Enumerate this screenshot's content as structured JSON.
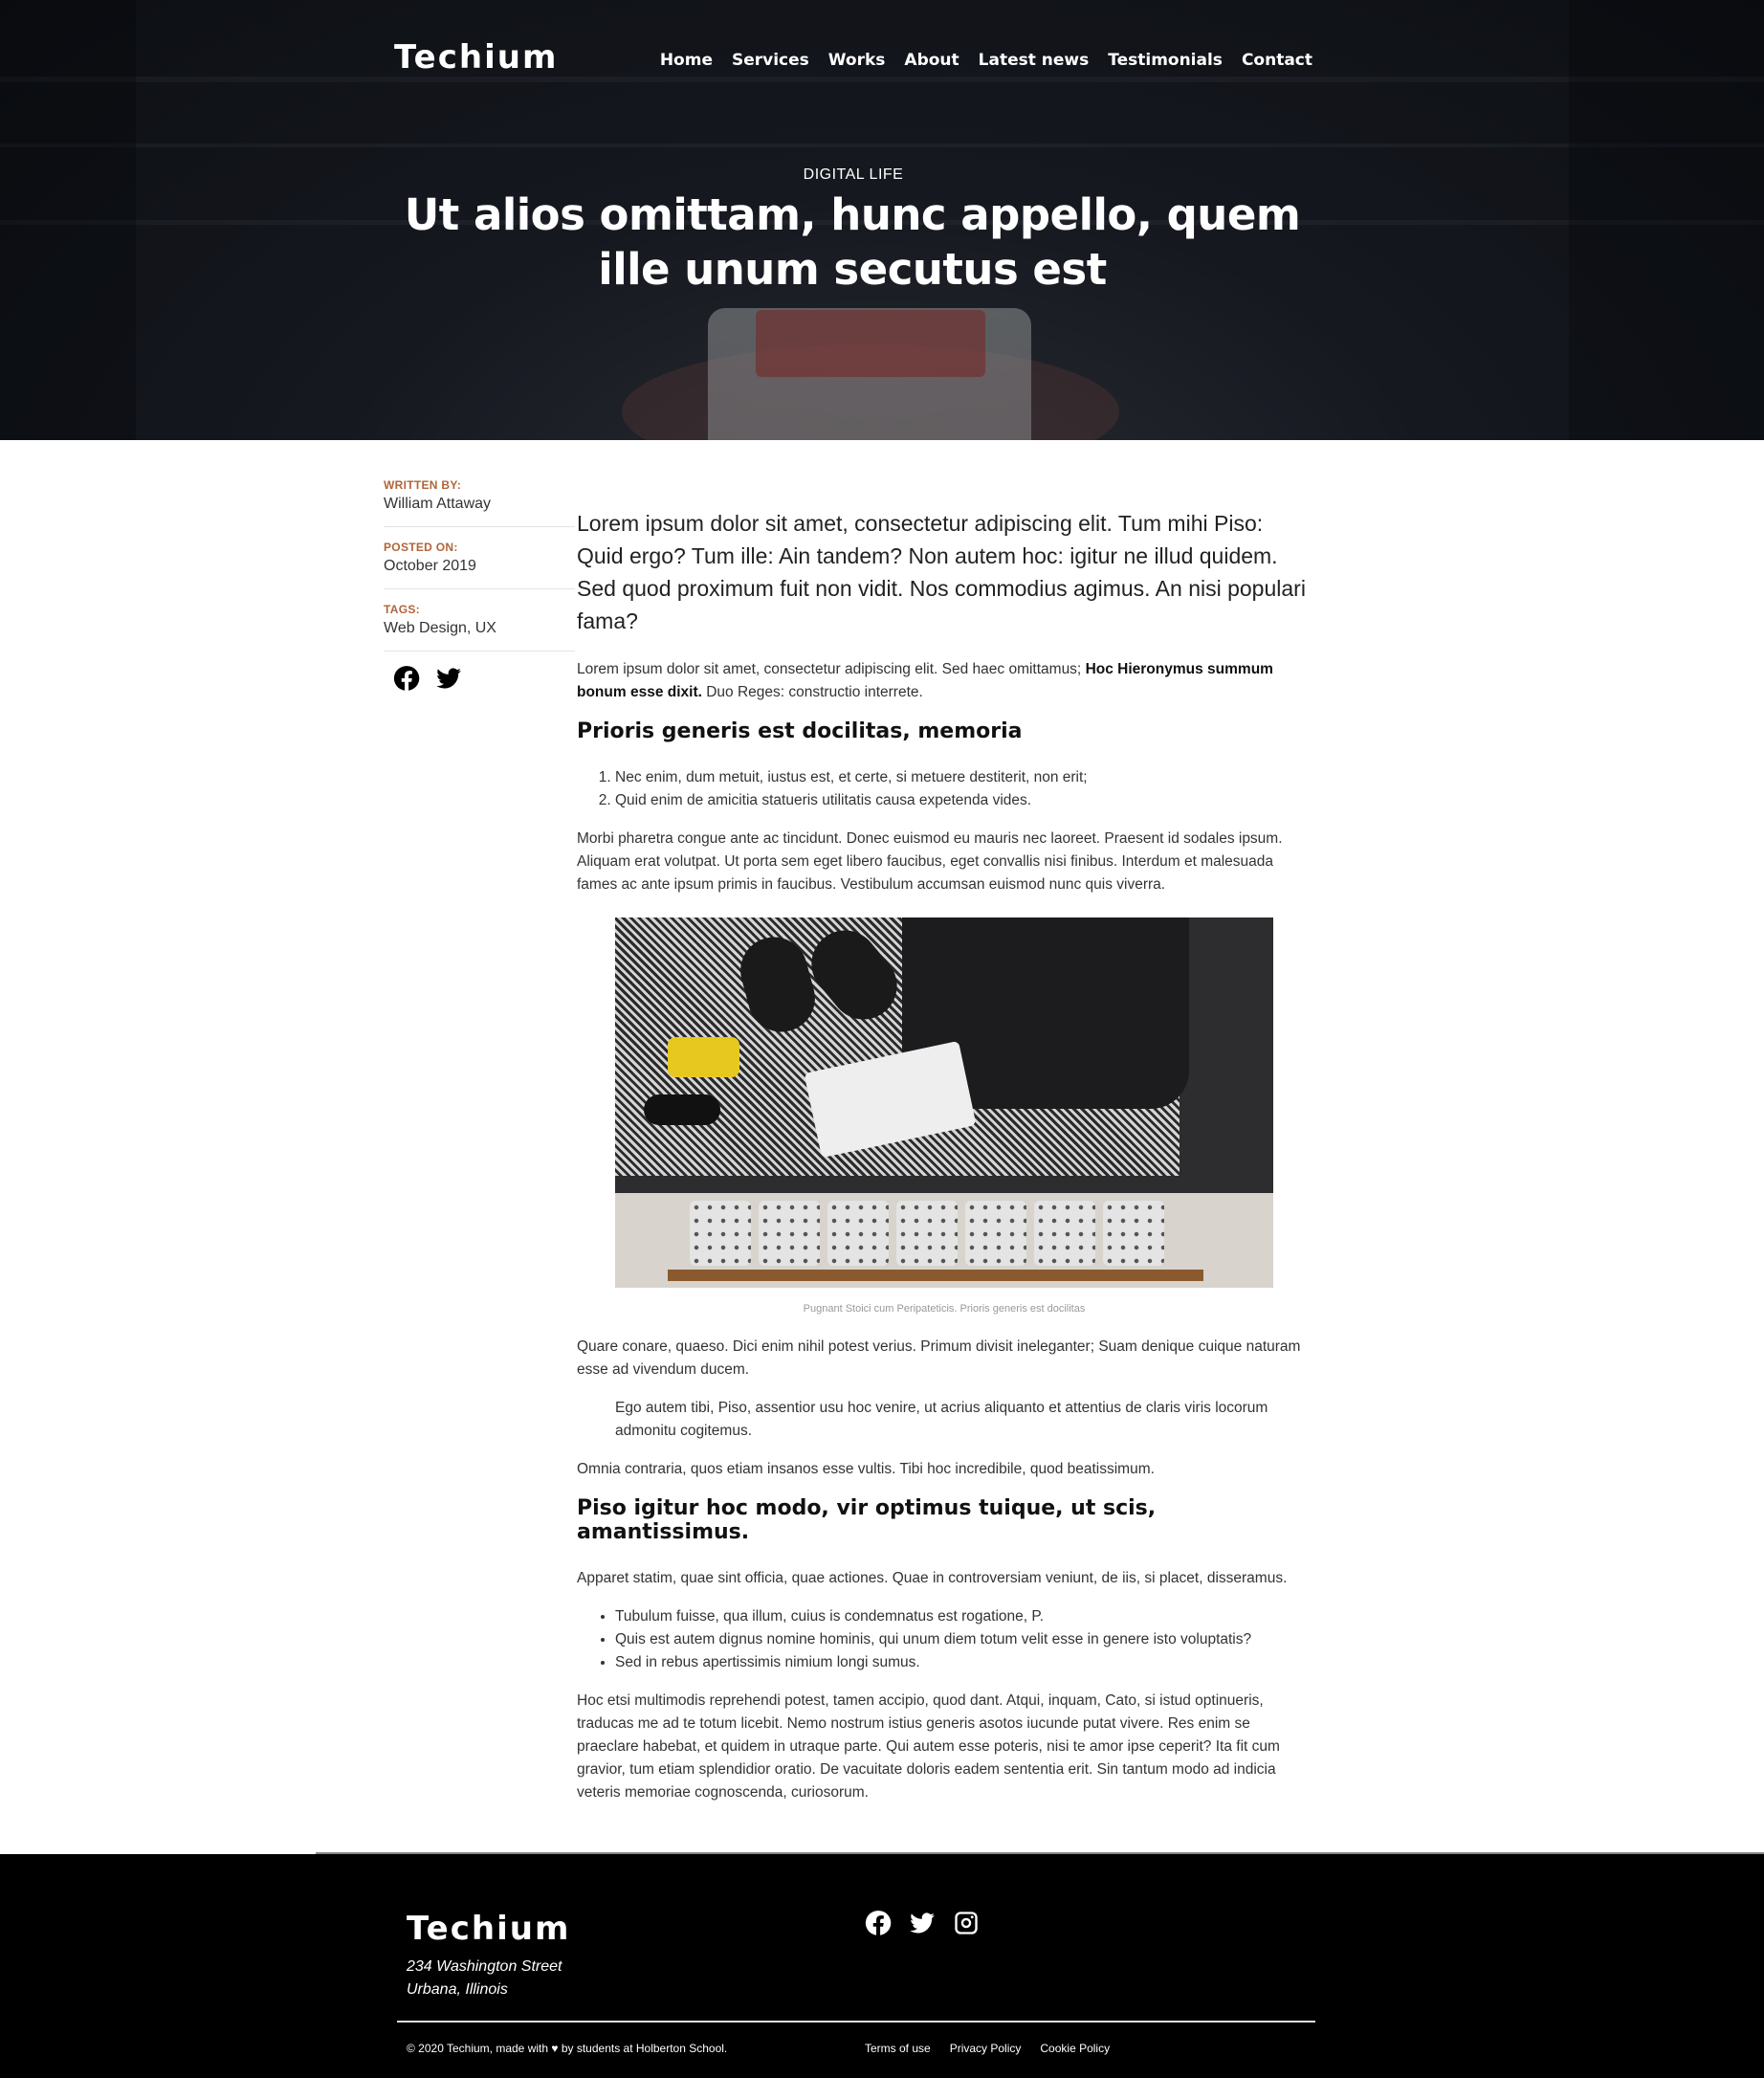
{
  "brand": {
    "name": "Techium"
  },
  "nav": {
    "items": [
      {
        "label": "Home"
      },
      {
        "label": "Services"
      },
      {
        "label": "Works"
      },
      {
        "label": "About"
      },
      {
        "label": "Latest news"
      },
      {
        "label": "Testimonials"
      },
      {
        "label": "Contact"
      }
    ]
  },
  "hero": {
    "category": "DIGITAL LIFE",
    "title": "Ut alios omittam, hunc appello, quem ille unum secutus est"
  },
  "sidebar": {
    "written_by_label": "WRITTEN BY:",
    "author": "William Attaway",
    "posted_on_label": "POSTED ON:",
    "date": "October 2019",
    "tags_label": "TAGS:",
    "tags": "Web Design, UX",
    "social": [
      "facebook-icon",
      "twitter-icon"
    ]
  },
  "article": {
    "lead": "Lorem ipsum dolor sit amet, consectetur adipiscing elit. Tum mihi Piso: Quid ergo? Tum ille: Ain tandem? Non autem hoc: igitur ne illud quidem. Sed quod proximum fuit non vidit. Nos commodius agimus. An nisi populari fama?",
    "p1_start": "Lorem ipsum dolor sit amet, consectetur adipiscing elit. Sed haec omittamus; ",
    "p1_bold": "Hoc Hieronymus summum bonum esse dixit.",
    "p1_end": " Duo Reges: constructio interrete.",
    "h2_1": "Prioris generis est docilitas, memoria",
    "ol": [
      "Nec enim, dum metuit, iustus est, et certe, si metuere destiterit, non erit;",
      "Quid enim de amicitia statueris utilitatis causa expetenda vides."
    ],
    "p2": "Morbi pharetra congue ante ac tincidunt. Donec euismod eu mauris nec laoreet. Praesent id sodales ipsum. Aliquam erat volutpat. Ut porta sem eget libero faucibus, eget convallis nisi finibus. Interdum et malesuada fames ac ante ipsum primis in faucibus. Vestibulum accumsan euismod nunc quis viverra.",
    "figcaption": "Pugnant Stoici cum Peripateticis. Prioris generis est docilitas",
    "p3": "Quare conare, quaeso. Dici enim nihil potest verius. Primum divisit ineleganter; Suam denique cuique naturam esse ad vivendum ducem.",
    "quote": "Ego autem tibi, Piso, assentior usu hoc venire, ut acrius aliquanto et attentius de claris viris locorum admonitu cogitemus.",
    "p4": "Omnia contraria, quos etiam insanos esse vultis. Tibi hoc incredibile, quod beatissimum.",
    "h2_2": "Piso igitur hoc modo, vir optimus tuique, ut scis, amantissimus.",
    "p5": "Apparet statim, quae sint officia, quae actiones. Quae in controversiam veniunt, de iis, si placet, disseramus.",
    "ul": [
      "Tubulum fuisse, qua illum, cuius is condemnatus est rogatione, P.",
      "Quis est autem dignus nomine hominis, qui unum diem totum velit esse in genere isto voluptatis?",
      "Sed in rebus apertissimis nimium longi sumus."
    ],
    "p6": "Hoc etsi multimodis reprehendi potest, tamen accipio, quod dant. Atqui, inquam, Cato, si istud optinueris, traducas me ad te totum licebit. Nemo nostrum istius generis asotos iucunde putat vivere. Res enim se praeclare habebat, et quidem in utraque parte. Qui autem esse poteris, nisi te amor ipse ceperit? Ita fit cum gravior, tum etiam splendidior oratio. De vacuitate doloris eadem sententia erit. Sin tantum modo ad indicia veteris memoriae cognoscenda, curiosorum."
  },
  "footer": {
    "brand": "Techium",
    "address_line1": "234 Washington Street",
    "address_line2": "Urbana, Illinois",
    "social": [
      "facebook-icon",
      "twitter-icon",
      "instagram-icon"
    ],
    "copyright": "© 2020 Techium, made with ♥ by students at Holberton School.",
    "links": [
      {
        "label": "Terms of use"
      },
      {
        "label": "Privacy Policy"
      },
      {
        "label": "Cookie Policy"
      }
    ]
  }
}
